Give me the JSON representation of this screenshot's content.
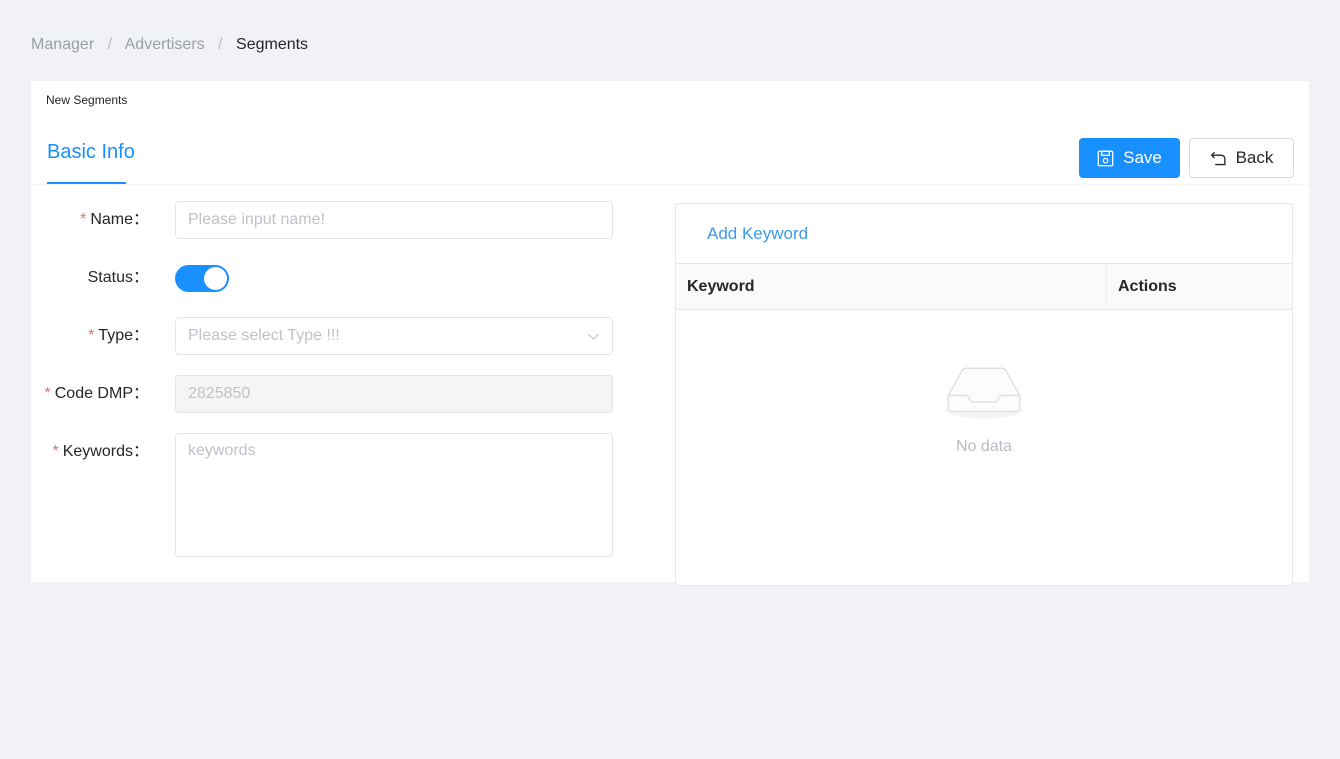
{
  "breadcrumb": {
    "items": [
      {
        "label": "Manager",
        "current": false
      },
      {
        "label": "Advertisers",
        "current": false
      },
      {
        "label": "Segments",
        "current": true
      }
    ],
    "separator": "/"
  },
  "card": {
    "title": "New Segments"
  },
  "tabs": [
    {
      "label": "Basic Info",
      "active": true
    }
  ],
  "toolbar": {
    "save_label": "Save",
    "save_icon": "save-icon",
    "back_label": "Back",
    "back_icon": "rollback-icon"
  },
  "form": {
    "name": {
      "label": "Name：",
      "required": true,
      "value": "",
      "placeholder": "Please input name!"
    },
    "status": {
      "label": "Status：",
      "required": false,
      "checked": true
    },
    "type": {
      "label": "Type：",
      "required": true,
      "value": "",
      "placeholder": "Please select Type !!!",
      "caret_icon": "chevron-down-icon"
    },
    "code_dmp": {
      "label": "Code DMP：",
      "required": true,
      "value": "2825850",
      "disabled": true
    },
    "keywords": {
      "label": "Keywords：",
      "required": true,
      "value": "",
      "placeholder": "keywords"
    }
  },
  "keyword_panel": {
    "add_link": "Add Keyword",
    "columns": [
      "Keyword",
      "Actions"
    ],
    "rows": [],
    "empty_text": "No data",
    "empty_icon": "empty-inbox-icon"
  },
  "colors": {
    "page_background": "#f0f2f5",
    "accent": "#1890ff",
    "link": "#3c9ae8",
    "required_mark": "#f5696e",
    "text": "#262626",
    "muted_text": "#bfc2c7",
    "border": "#e3e5e8",
    "table_header_bg": "#fafafa"
  }
}
